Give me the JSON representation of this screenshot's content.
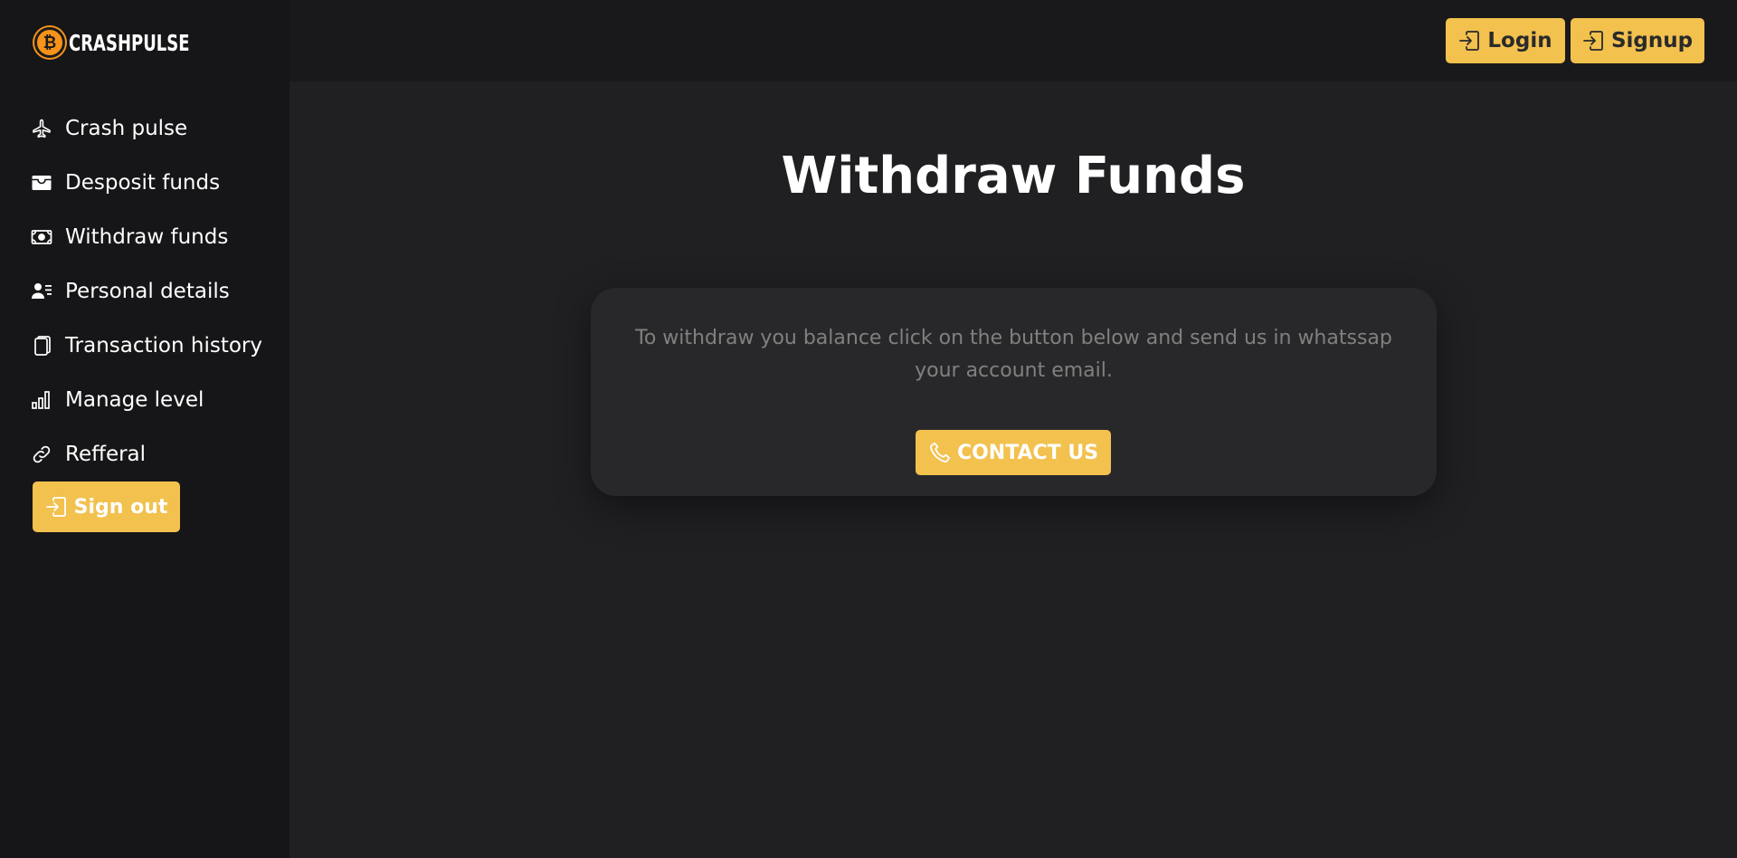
{
  "brand": {
    "name": "CRASHPULSE",
    "coin_symbol": "₿",
    "coin_icon": "bitcoin-icon"
  },
  "sidebar": {
    "items": [
      {
        "label": "Crash pulse",
        "icon": "airplane-icon"
      },
      {
        "label": "Desposit funds",
        "icon": "wallet-icon"
      },
      {
        "label": "Withdraw funds",
        "icon": "cash-icon"
      },
      {
        "label": "Personal details",
        "icon": "person-lines-icon"
      },
      {
        "label": "Transaction history",
        "icon": "files-icon"
      },
      {
        "label": "Manage level",
        "icon": "bar-chart-icon"
      },
      {
        "label": "Refferal",
        "icon": "link-icon"
      }
    ],
    "signout_label": "Sign out"
  },
  "header": {
    "login_label": "Login",
    "signup_label": "Signup"
  },
  "main": {
    "title": "Withdraw Funds",
    "card": {
      "text": "To withdraw you balance click on the button below and send us in whatssap your account email.",
      "button_label": "CONTACT US"
    }
  },
  "colors": {
    "accent": "#f2c14e",
    "sidebar_bg": "#161618",
    "topbar_bg": "#19191b",
    "page_bg": "#202023",
    "card_bg": "#28282a",
    "muted_text": "#808080"
  }
}
